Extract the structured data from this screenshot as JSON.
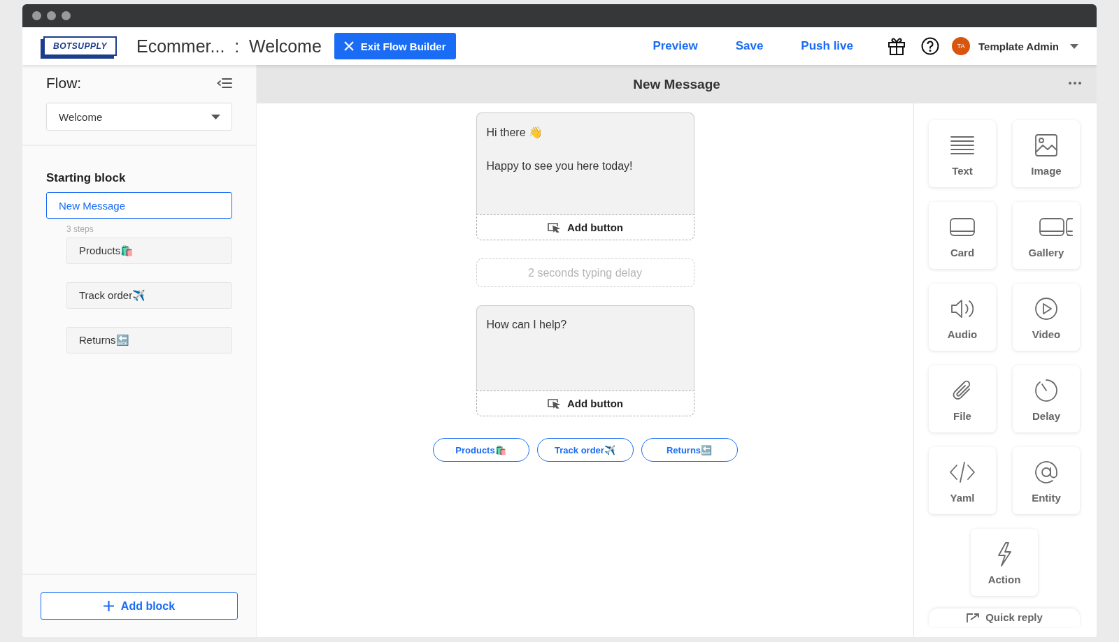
{
  "header": {
    "logo": "BOTSUPPLY",
    "title": "Ecommer...  :  Welcome",
    "exit_button": "Exit Flow Builder",
    "links": [
      "Preview",
      "Save",
      "Push live"
    ],
    "user": {
      "initials": "TA",
      "name": "Template Admin"
    }
  },
  "sidebar": {
    "heading": "Flow:",
    "flow_select": "Welcome",
    "section": "Starting block",
    "blocks": [
      {
        "label": "New Message",
        "selected": true,
        "steps": "3 steps",
        "children": [
          {
            "label": "Products🛍️",
            "selected": false
          },
          {
            "label": "Track order✈️",
            "selected": false
          },
          {
            "label": "Returns🔙",
            "selected": false
          }
        ]
      }
    ],
    "add_block": "Add block"
  },
  "canvas": {
    "title": "New Message",
    "steps": [
      {
        "kind": "message",
        "lines": [
          "Hi there 👋",
          "Happy to see you here today!"
        ],
        "add_button": "Add button"
      },
      {
        "kind": "delay",
        "text": "2 seconds typing delay"
      },
      {
        "kind": "message",
        "lines": [
          "How can I help?"
        ],
        "add_button": "Add button"
      }
    ],
    "quick_replies": [
      "Products🛍️",
      "Track order✈️",
      "Returns🔙"
    ]
  },
  "palette": {
    "items": [
      "Text",
      "Image",
      "Card",
      "Gallery",
      "Audio",
      "Video",
      "File",
      "Delay",
      "Yaml",
      "Entity",
      "Action"
    ],
    "quick_reply": "Quick reply"
  }
}
